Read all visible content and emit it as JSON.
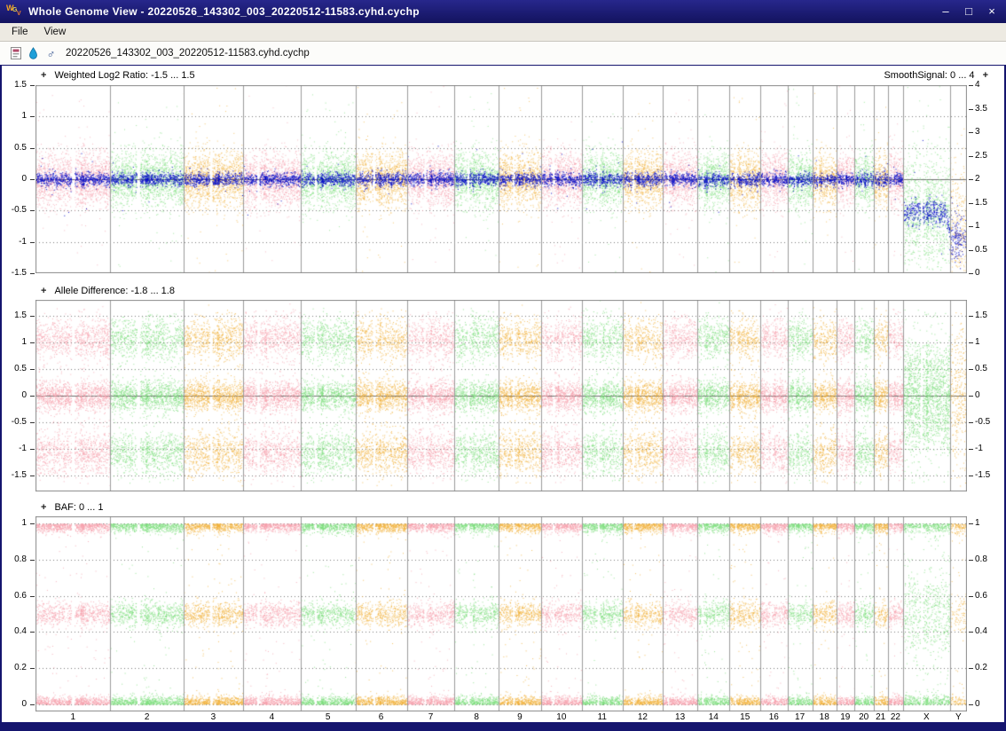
{
  "window": {
    "title": "Whole Genome View - 20220526_143302_003_20220512-11583.cyhd.cychp",
    "controls": {
      "minimize": "–",
      "maximize": "□",
      "close": "×"
    }
  },
  "menu": {
    "items": [
      "File",
      "View"
    ]
  },
  "toolbar": {
    "filename": "20220526_143302_003_20220512-11583.cyhd.cychp",
    "icons": [
      "array-file-icon",
      "droplet-icon",
      "male-symbol-icon"
    ]
  },
  "ui": {
    "expand_label": "+"
  },
  "palette": [
    "#F7A1AE",
    "#7FE07F",
    "#F3B33C"
  ],
  "smooth_color": "#0008C8",
  "chromosomes": [
    {
      "name": "1",
      "size": 249,
      "cen": 0.5
    },
    {
      "name": "2",
      "size": 243,
      "cen": 0.38
    },
    {
      "name": "3",
      "size": 198,
      "cen": 0.46
    },
    {
      "name": "4",
      "size": 191,
      "cen": 0.26
    },
    {
      "name": "5",
      "size": 182,
      "cen": 0.27
    },
    {
      "name": "6",
      "size": 171,
      "cen": 0.36
    },
    {
      "name": "7",
      "size": 159,
      "cen": 0.38
    },
    {
      "name": "8",
      "size": 146,
      "cen": 0.31
    },
    {
      "name": "9",
      "size": 141,
      "cen": 0.35
    },
    {
      "name": "10",
      "size": 136,
      "cen": 0.3
    },
    {
      "name": "11",
      "size": 135,
      "cen": 0.4
    },
    {
      "name": "12",
      "size": 134,
      "cen": 0.27
    },
    {
      "name": "13",
      "size": 115,
      "cen": 0.15
    },
    {
      "name": "14",
      "size": 107,
      "cen": 0.16
    },
    {
      "name": "15",
      "size": 102,
      "cen": 0.19
    },
    {
      "name": "16",
      "size": 90,
      "cen": 0.41
    },
    {
      "name": "17",
      "size": 83,
      "cen": 0.3
    },
    {
      "name": "18",
      "size": 80,
      "cen": 0.23
    },
    {
      "name": "19",
      "size": 59,
      "cen": 0.45
    },
    {
      "name": "20",
      "size": 64,
      "cen": 0.44
    },
    {
      "name": "21",
      "size": 48,
      "cen": 0.26
    },
    {
      "name": "22",
      "size": 51,
      "cen": 0.3
    },
    {
      "name": "X",
      "size": 155,
      "cen": 0.39
    },
    {
      "name": "Y",
      "size": 57,
      "cen": 0.21
    }
  ],
  "chart_data": [
    {
      "type": "scatter",
      "kind": "log2",
      "title": "Weighted Log2 Ratio: -1.5 ... 1.5",
      "right_axis_title": "SmoothSignal: 0 ... 4",
      "ylim": [
        -1.5,
        1.5
      ],
      "right_ylim": [
        0,
        4
      ],
      "yticks": [
        {
          "label": "1.5",
          "value": 1.5
        },
        {
          "label": "1",
          "value": 1
        },
        {
          "label": "0.5",
          "value": 0.5
        },
        {
          "label": "0",
          "value": 0
        },
        {
          "label": "-0.5",
          "value": -0.5
        },
        {
          "label": "-1",
          "value": -1
        },
        {
          "label": "-1.5",
          "value": -1.5
        }
      ],
      "right_yticks": [
        {
          "label": "4",
          "value": 4
        },
        {
          "label": "3.5",
          "value": 3.5
        },
        {
          "label": "3",
          "value": 3
        },
        {
          "label": "2.5",
          "value": 2.5
        },
        {
          "label": "2",
          "value": 2
        },
        {
          "label": "1.5",
          "value": 1.5
        },
        {
          "label": "1",
          "value": 1
        },
        {
          "label": "0.5",
          "value": 0.5
        },
        {
          "label": "0",
          "value": 0
        }
      ],
      "zero_line": true,
      "density": 20,
      "smooth_density": 8,
      "outlier_frac": 0.025,
      "series": {
        "scatter_mean": 0,
        "scatter_sd": 0.22,
        "smooth_mean": 0,
        "smooth_sd": 0.055
      },
      "overrides": {
        "X": {
          "scatter_mean": -0.5,
          "scatter_sd": 0.48,
          "smooth_mean": -0.52,
          "smooth_sd": 0.1,
          "density_factor": 1.1
        },
        "Y": {
          "scatter_mean": -0.85,
          "scatter_sd": 0.58,
          "smooth_mean": -0.95,
          "smooth_sd": 0.2,
          "density_factor": 0.8
        }
      }
    },
    {
      "type": "scatter",
      "kind": "bands",
      "title": "Allele Difference: -1.8 ... 1.8",
      "ylim": [
        -1.8,
        1.8
      ],
      "yticks": [
        {
          "label": "1.5",
          "value": 1.5
        },
        {
          "label": "1",
          "value": 1
        },
        {
          "label": "0.5",
          "value": 0.5
        },
        {
          "label": "0",
          "value": 0
        },
        {
          "label": "-0.5",
          "value": -0.5
        },
        {
          "label": "-1",
          "value": -1
        },
        {
          "label": "-1.5",
          "value": -1.5
        }
      ],
      "zero_line": true,
      "density": 34,
      "uniform_frac": 0.06,
      "data_range": [
        -1.65,
        1.65
      ],
      "bands": [
        {
          "mean": 0,
          "sd": 0.14,
          "w": 0.4
        },
        {
          "mean": 1.07,
          "sd": 0.19,
          "w": 0.27
        },
        {
          "mean": -1.07,
          "sd": 0.19,
          "w": 0.27
        }
      ],
      "overrides": {
        "X": {
          "bands": [
            {
              "mean": 0,
              "sd": 0.2,
              "w": 0.4
            },
            {
              "mean": 0.55,
              "sd": 0.24,
              "w": 0.3
            },
            {
              "mean": -0.55,
              "sd": 0.24,
              "w": 0.3
            }
          ],
          "uniform_frac": 0.1
        },
        "Y": {
          "bands": [
            {
              "mean": 0,
              "sd": 0.55,
              "w": 1
            }
          ],
          "uniform_frac": 0.25,
          "density_factor": 0.5
        }
      }
    },
    {
      "type": "scatter",
      "kind": "bands",
      "title": "BAF: 0 ... 1",
      "ylim": [
        -0.04,
        1.04
      ],
      "yticks": [
        {
          "label": "1",
          "value": 1
        },
        {
          "label": "0.8",
          "value": 0.8
        },
        {
          "label": "0.6",
          "value": 0.6
        },
        {
          "label": "0.4",
          "value": 0.4
        },
        {
          "label": "0.2",
          "value": 0.2
        },
        {
          "label": "0",
          "value": 0
        }
      ],
      "zero_line": false,
      "density": 26,
      "uniform_frac": 0.035,
      "data_range": [
        0,
        1
      ],
      "bands": [
        {
          "mean": 0,
          "sd": 0.022,
          "w": 0.33,
          "half": "up"
        },
        {
          "mean": 0.5,
          "sd": 0.035,
          "w": 0.3
        },
        {
          "mean": 1,
          "sd": 0.022,
          "w": 0.33,
          "half": "down"
        }
      ],
      "overrides": {
        "X": {
          "bands": [
            {
              "mean": 0,
              "sd": 0.025,
              "w": 0.26,
              "half": "up"
            },
            {
              "mean": 0.42,
              "sd": 0.07,
              "w": 0.19
            },
            {
              "mean": 0.58,
              "sd": 0.07,
              "w": 0.19
            },
            {
              "mean": 1,
              "sd": 0.025,
              "w": 0.26,
              "half": "down"
            }
          ],
          "uniform_frac": 0.1
        },
        "Y": {
          "bands": [
            {
              "mean": 0,
              "sd": 0.025,
              "w": 0.33,
              "half": "up"
            },
            {
              "mean": 0.5,
              "sd": 0.06,
              "w": 0.3
            },
            {
              "mean": 1,
              "sd": 0.025,
              "w": 0.33,
              "half": "down"
            }
          ],
          "uniform_frac": 0.1,
          "density_factor": 0.6
        }
      }
    }
  ]
}
